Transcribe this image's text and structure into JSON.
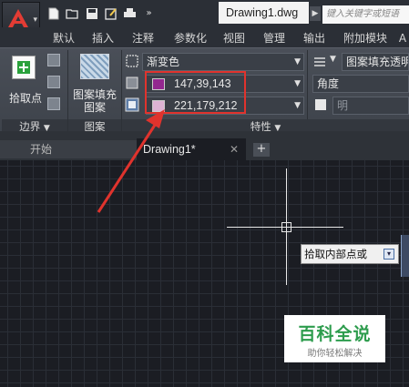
{
  "title_bar": {
    "document_title": "Drawing1.dwg",
    "search_placeholder": "键入关键字或短语"
  },
  "ribbon_tabs": [
    "默认",
    "插入",
    "注释",
    "参数化",
    "视图",
    "管理",
    "输出",
    "附加模块",
    "A"
  ],
  "ribbon": {
    "pick_points_label": "拾取点",
    "hatch_creation_label_1": "图案填充",
    "hatch_creation_label_2": "图案",
    "boundary_panel": "边界",
    "pattern_panel": "图案",
    "properties_panel": "特性",
    "hatch_type": "渐变色",
    "color1": {
      "text": "147,39,143",
      "swatch": "#93278F"
    },
    "color2": {
      "text": "221,179,212",
      "swatch": "#DDB3D4"
    },
    "transparency_label": "图案填充透明",
    "angle_label": "角度",
    "shade_label": "明"
  },
  "doc_tabs": {
    "start": "开始",
    "active": "Drawing1*",
    "close_glyph": "✕",
    "add_glyph": "+"
  },
  "canvas": {
    "tooltip": "拾取内部点或"
  },
  "watermark": {
    "title": "百科全说",
    "subtitle": "助你轻松解决"
  },
  "colors": {
    "annotation_red": "#E0332D",
    "accent_green": "#2D9C4D"
  }
}
